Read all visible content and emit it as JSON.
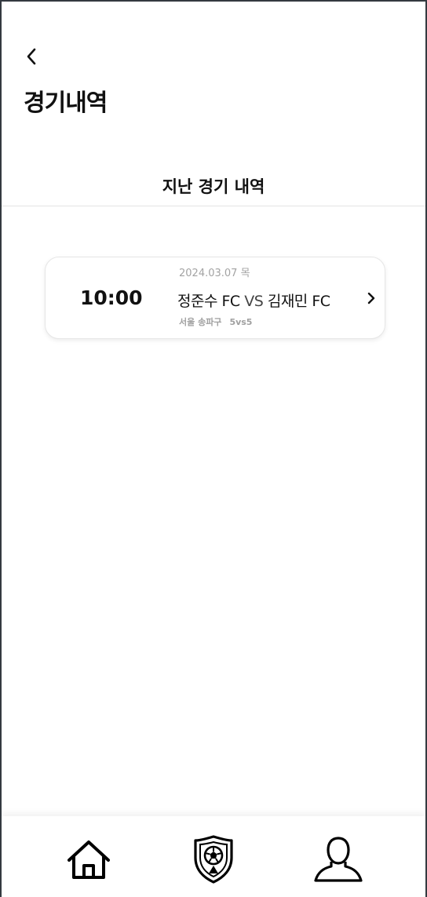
{
  "header": {
    "title": "경기내역"
  },
  "tabs": [
    {
      "label": "지난 경기 내역"
    }
  ],
  "matches": [
    {
      "date": "2024.03.07 목",
      "time": "10:00",
      "home_team": "정준수 FC",
      "vs": "VS",
      "away_team": "김재민 FC",
      "location": "서울 송파구",
      "format": "5vs5"
    }
  ],
  "bottom_nav": {
    "items": [
      {
        "icon": "home-icon"
      },
      {
        "icon": "soccer-shield-icon"
      },
      {
        "icon": "person-icon"
      }
    ]
  }
}
